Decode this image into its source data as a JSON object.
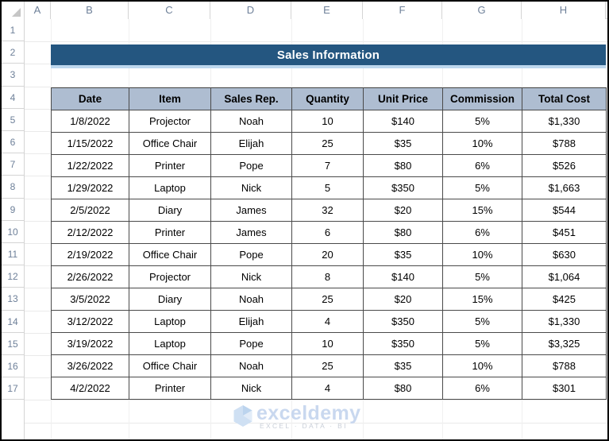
{
  "app": {
    "type": "spreadsheet",
    "select_all_icon": "select-all-triangle-icon"
  },
  "grid": {
    "column_letters": [
      "A",
      "B",
      "C",
      "D",
      "E",
      "F",
      "G",
      "H"
    ],
    "row_numbers": [
      "1",
      "2",
      "3",
      "4",
      "5",
      "6",
      "7",
      "8",
      "9",
      "10",
      "11",
      "12",
      "13",
      "14",
      "15",
      "16",
      "17"
    ]
  },
  "title_banner": {
    "text": "Sales Information",
    "fill_color": "#245680",
    "text_color": "#FFFFFF",
    "underline_color": "#BDD7EE"
  },
  "table": {
    "header_fill": "#AEBDD1",
    "border_color": "#4A4A4A",
    "headers": [
      "Date",
      "Item",
      "Sales Rep.",
      "Quantity",
      "Unit Price",
      "Commission",
      "Total Cost"
    ],
    "rows": [
      [
        "1/8/2022",
        "Projector",
        "Noah",
        "10",
        "$140",
        "5%",
        "$1,330"
      ],
      [
        "1/15/2022",
        "Office Chair",
        "Elijah",
        "25",
        "$35",
        "10%",
        "$788"
      ],
      [
        "1/22/2022",
        "Printer",
        "Pope",
        "7",
        "$80",
        "6%",
        "$526"
      ],
      [
        "1/29/2022",
        "Laptop",
        "Nick",
        "5",
        "$350",
        "5%",
        "$1,663"
      ],
      [
        "2/5/2022",
        "Diary",
        "James",
        "32",
        "$20",
        "15%",
        "$544"
      ],
      [
        "2/12/2022",
        "Printer",
        "James",
        "6",
        "$80",
        "6%",
        "$451"
      ],
      [
        "2/19/2022",
        "Office Chair",
        "Pope",
        "20",
        "$35",
        "10%",
        "$630"
      ],
      [
        "2/26/2022",
        "Projector",
        "Nick",
        "8",
        "$140",
        "5%",
        "$1,064"
      ],
      [
        "3/5/2022",
        "Diary",
        "Noah",
        "25",
        "$20",
        "15%",
        "$425"
      ],
      [
        "3/12/2022",
        "Laptop",
        "Elijah",
        "4",
        "$350",
        "5%",
        "$1,330"
      ],
      [
        "3/19/2022",
        "Laptop",
        "Pope",
        "10",
        "$350",
        "5%",
        "$3,325"
      ],
      [
        "3/26/2022",
        "Office Chair",
        "Noah",
        "25",
        "$35",
        "10%",
        "$788"
      ],
      [
        "4/2/2022",
        "Printer",
        "Nick",
        "4",
        "$80",
        "6%",
        "$301"
      ]
    ]
  },
  "watermark": {
    "brand": "exceldemy",
    "tagline": "EXCEL · DATA · BI",
    "color": "#C9D8EF"
  }
}
